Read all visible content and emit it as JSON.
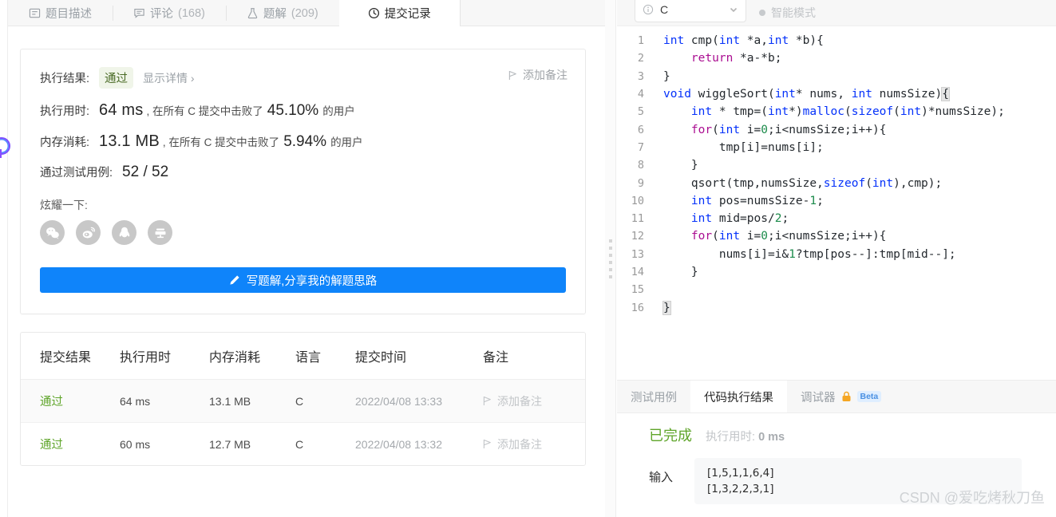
{
  "tabs": [
    {
      "label": "题目描述",
      "icon": "description-icon",
      "count": "",
      "active": false
    },
    {
      "label": "评论",
      "icon": "comment-icon",
      "count": "(168)",
      "active": false
    },
    {
      "label": "题解",
      "icon": "flask-icon",
      "count": "(209)",
      "active": false
    },
    {
      "label": "提交记录",
      "icon": "clock-icon",
      "count": "",
      "active": true
    }
  ],
  "result": {
    "exec_result_label": "执行结果:",
    "status": "通过",
    "show_detail": "显示详情 ›",
    "add_note": "添加备注",
    "runtime_label": "执行用时:",
    "runtime_value": "64 ms",
    "runtime_mid": ", 在所有 C 提交中击败了",
    "runtime_pct": "45.10%",
    "runtime_suffix": "的用户",
    "memory_label": "内存消耗:",
    "memory_value": "13.1 MB",
    "memory_mid": ", 在所有 C 提交中击败了",
    "memory_pct": "5.94%",
    "memory_suffix": "的用户",
    "testcase_label": "通过测试用例:",
    "testcase_value": "52 / 52",
    "share_label": "炫耀一下:",
    "share_icons": [
      "wechat-icon",
      "weibo-icon",
      "qq-icon",
      "qzone-icon"
    ],
    "write_button": "写题解,分享我的解题思路"
  },
  "table": {
    "headers": [
      "提交结果",
      "执行用时",
      "内存消耗",
      "语言",
      "提交时间",
      "备注"
    ],
    "rows": [
      {
        "status": "通过",
        "runtime": "64 ms",
        "memory": "13.1 MB",
        "lang": "C",
        "time": "2022/04/08 13:33",
        "note": "添加备注"
      },
      {
        "status": "通过",
        "runtime": "60 ms",
        "memory": "12.7 MB",
        "lang": "C",
        "time": "2022/04/08 13:32",
        "note": "添加备注"
      }
    ]
  },
  "editor": {
    "language": "C",
    "smart_mode": "智能模式",
    "lines": [
      {
        "n": "1",
        "html": "<span class='kw'>int</span> cmp(<span class='kw'>int</span> *a,<span class='kw'>int</span> *b){"
      },
      {
        "n": "2",
        "html": "    <span class='kw2'>return</span> *a-*b;"
      },
      {
        "n": "3",
        "html": "}"
      },
      {
        "n": "4",
        "html": "<span class='kw'>void</span> wiggleSort(<span class='kw'>int</span>* nums, <span class='kw'>int</span> numsSize)<span class='brace-hl'>{</span>"
      },
      {
        "n": "5",
        "html": "    <span class='kw'>int</span> * tmp=(<span class='kw'>int</span>*)<span class='kw'>malloc</span>(<span class='kw'>sizeof</span>(<span class='kw'>int</span>)*numsSize);"
      },
      {
        "n": "6",
        "html": "    <span class='kw2'>for</span>(<span class='kw'>int</span> i=<span class='num'>0</span>;i&lt;numsSize;i++){"
      },
      {
        "n": "7",
        "html": "        tmp[i]=nums[i];"
      },
      {
        "n": "8",
        "html": "    }"
      },
      {
        "n": "9",
        "html": "    qsort(tmp,numsSize,<span class='kw'>sizeof</span>(<span class='kw'>int</span>),cmp);"
      },
      {
        "n": "10",
        "html": "    <span class='kw'>int</span> pos=numsSize-<span class='num'>1</span>;"
      },
      {
        "n": "11",
        "html": "    <span class='kw'>int</span> mid=pos/<span class='num'>2</span>;"
      },
      {
        "n": "12",
        "html": "    <span class='kw2'>for</span>(<span class='kw'>int</span> i=<span class='num'>0</span>;i&lt;numsSize;i++){"
      },
      {
        "n": "13",
        "html": "        nums[i]=i&amp;<span class='num'>1</span>?tmp[pos--]:tmp[mid--];"
      },
      {
        "n": "14",
        "html": "    }"
      },
      {
        "n": "15",
        "html": ""
      },
      {
        "n": "16",
        "html": "<span class='brace-hl'>}</span>"
      }
    ]
  },
  "console": {
    "tabs": [
      {
        "label": "测试用例",
        "active": false,
        "lock": false,
        "beta": ""
      },
      {
        "label": "代码执行结果",
        "active": true,
        "lock": false,
        "beta": ""
      },
      {
        "label": "调试器",
        "active": false,
        "lock": true,
        "beta": "Beta"
      }
    ],
    "status": "已完成",
    "runtime_label": "执行用时:",
    "runtime_value": "0 ms",
    "input_label": "输入",
    "input_lines": [
      "[1,5,1,1,6,4]",
      "[1,3,2,2,3,1]"
    ],
    "watermark": "CSDN @爱吃烤秋刀鱼"
  },
  "colors": {
    "accent_blue": "#0f84fa",
    "pass_green": "#5fa52a",
    "pill_bg": "#f0f5e9",
    "keyword_blue": "#0431fa",
    "keyword_purple": "#aa0d91",
    "number_green": "#1c8b4b"
  }
}
